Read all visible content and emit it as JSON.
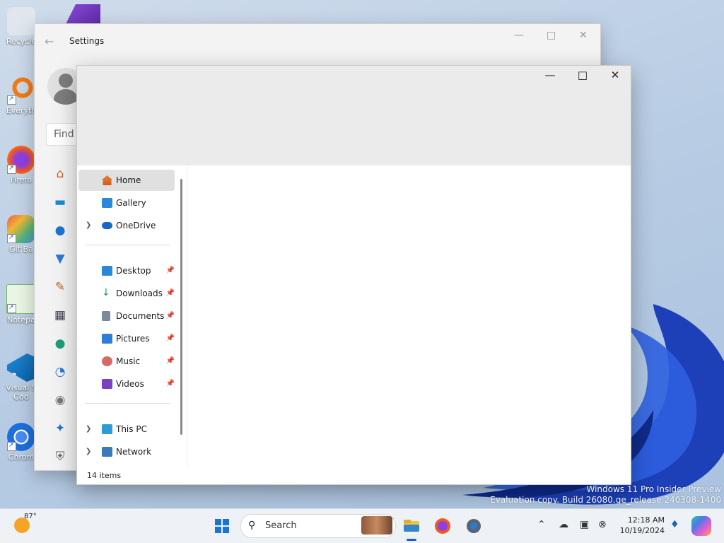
{
  "desktop": {
    "icons": [
      {
        "label": "Recycle"
      },
      {
        "label": "Everyth"
      },
      {
        "label": "Firefo"
      },
      {
        "label": "Git Ba"
      },
      {
        "label": "Notepa"
      },
      {
        "label": "Visual S\nCod"
      },
      {
        "label": "Chrom"
      }
    ],
    "watermark_line1": "Windows 11 Pro Insider Preview",
    "watermark_line2": "Evaluation copy. Build 26080.ge_release.240308-1400"
  },
  "settings": {
    "title": "Settings",
    "search_placeholder": "Find a",
    "nav_icons": [
      "home-icon",
      "system-icon",
      "bluetooth-icon",
      "network-icon",
      "personalization-icon",
      "apps-icon",
      "accounts-icon",
      "time-language-icon",
      "gaming-icon",
      "accessibility-icon",
      "privacy-icon"
    ]
  },
  "explorer": {
    "nav": {
      "home": "Home",
      "gallery": "Gallery",
      "onedrive": "OneDrive",
      "desktop": "Desktop",
      "downloads": "Downloads",
      "documents": "Documents",
      "pictures": "Pictures",
      "music": "Music",
      "videos": "Videos",
      "thispc": "This PC",
      "network": "Network"
    },
    "status": "14 items"
  },
  "taskbar": {
    "temperature": "87°",
    "search_label": "Search",
    "time": "12:18 AM",
    "date": "10/19/2024"
  },
  "colors": {
    "accent": "#0a64c4",
    "selected_nav": "#e0e0e0"
  }
}
